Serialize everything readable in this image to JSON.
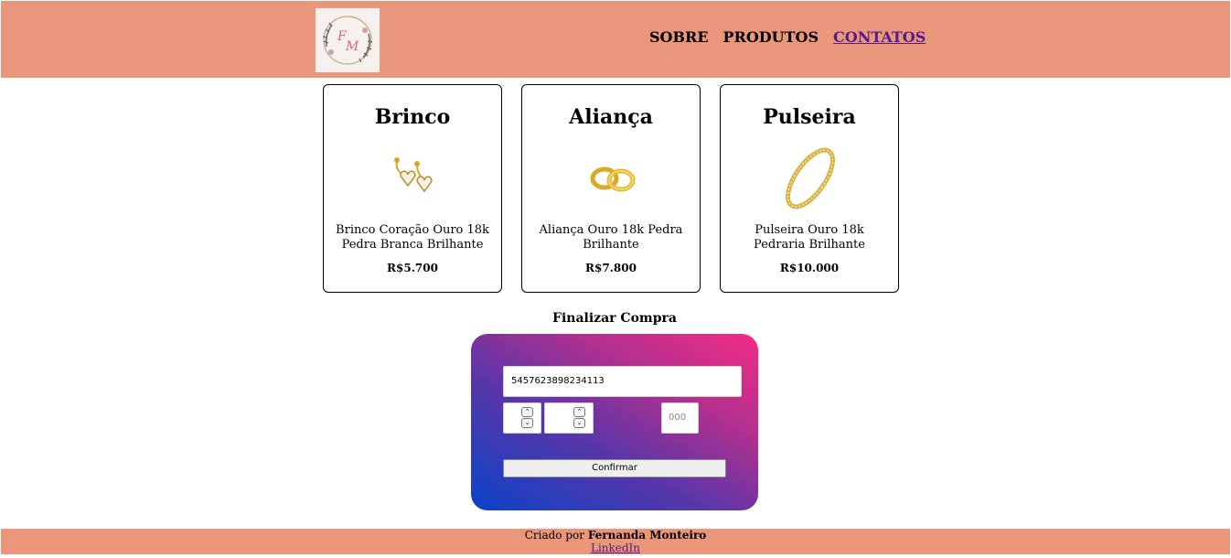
{
  "header": {
    "logo_initials": "FM",
    "nav": [
      {
        "label": "SOBRE"
      },
      {
        "label": "PRODUTOS"
      },
      {
        "label": "CONTATOS"
      }
    ]
  },
  "products": [
    {
      "title": "Brinco",
      "description": "Brinco Coração Ouro 18k Pedra Branca Brilhante",
      "price": "R$5.700",
      "icon": "earring-image"
    },
    {
      "title": "Aliança",
      "description": "Aliança Ouro 18k Pedra Brilhante",
      "price": "R$7.800",
      "icon": "ring-image"
    },
    {
      "title": "Pulseira",
      "description": "Pulseira Ouro 18k Pedraria Brilhante",
      "price": "R$10.000",
      "icon": "bracelet-image"
    }
  ],
  "checkout": {
    "title": "Finalizar Compra",
    "card_number_value": "5457623898234113",
    "cvv_placeholder": "000",
    "confirm_label": "Confirmar"
  },
  "footer": {
    "created_by_prefix": "Criado por",
    "author": "Fernanda Monteiro",
    "link_label": "LinkedIn"
  },
  "colors": {
    "header_bg": "#e9967a",
    "gradient_start": "#0a43c8",
    "gradient_end": "#f22c84",
    "link_visited": "#551a8b"
  }
}
